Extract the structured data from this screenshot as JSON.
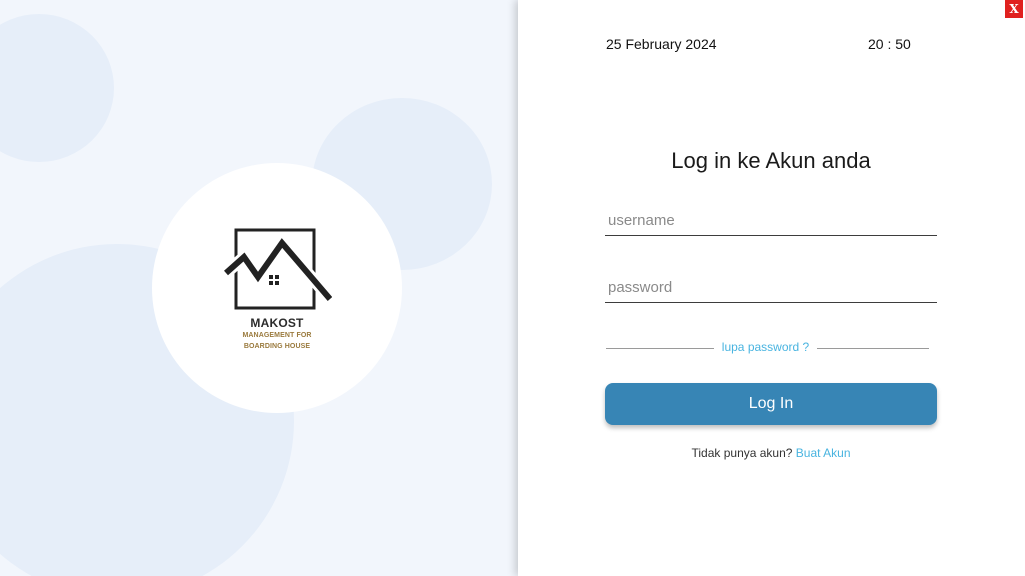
{
  "brand": {
    "name": "MAKOST",
    "tagline_line1": "MANAGEMENT FOR",
    "tagline_line2": "BOARDING HOUSE"
  },
  "header": {
    "date": "25 February 2024",
    "time": "20 : 50",
    "close_label": "X"
  },
  "login": {
    "title": "Log in ke Akun anda",
    "username_placeholder": "username",
    "username_value": "",
    "password_placeholder": "password",
    "password_value": "",
    "forgot_label": "lupa password ?",
    "submit_label": "Log In",
    "no_account_text": "Tidak punya akun?",
    "create_account_label": "Buat Akun"
  },
  "colors": {
    "primary_button": "#3785b5",
    "link": "#49b4e0",
    "close": "#e0211f",
    "brand_gold": "#9a7a3d"
  },
  "icons": {
    "logo": "house-roof-logo",
    "close": "close-icon"
  }
}
